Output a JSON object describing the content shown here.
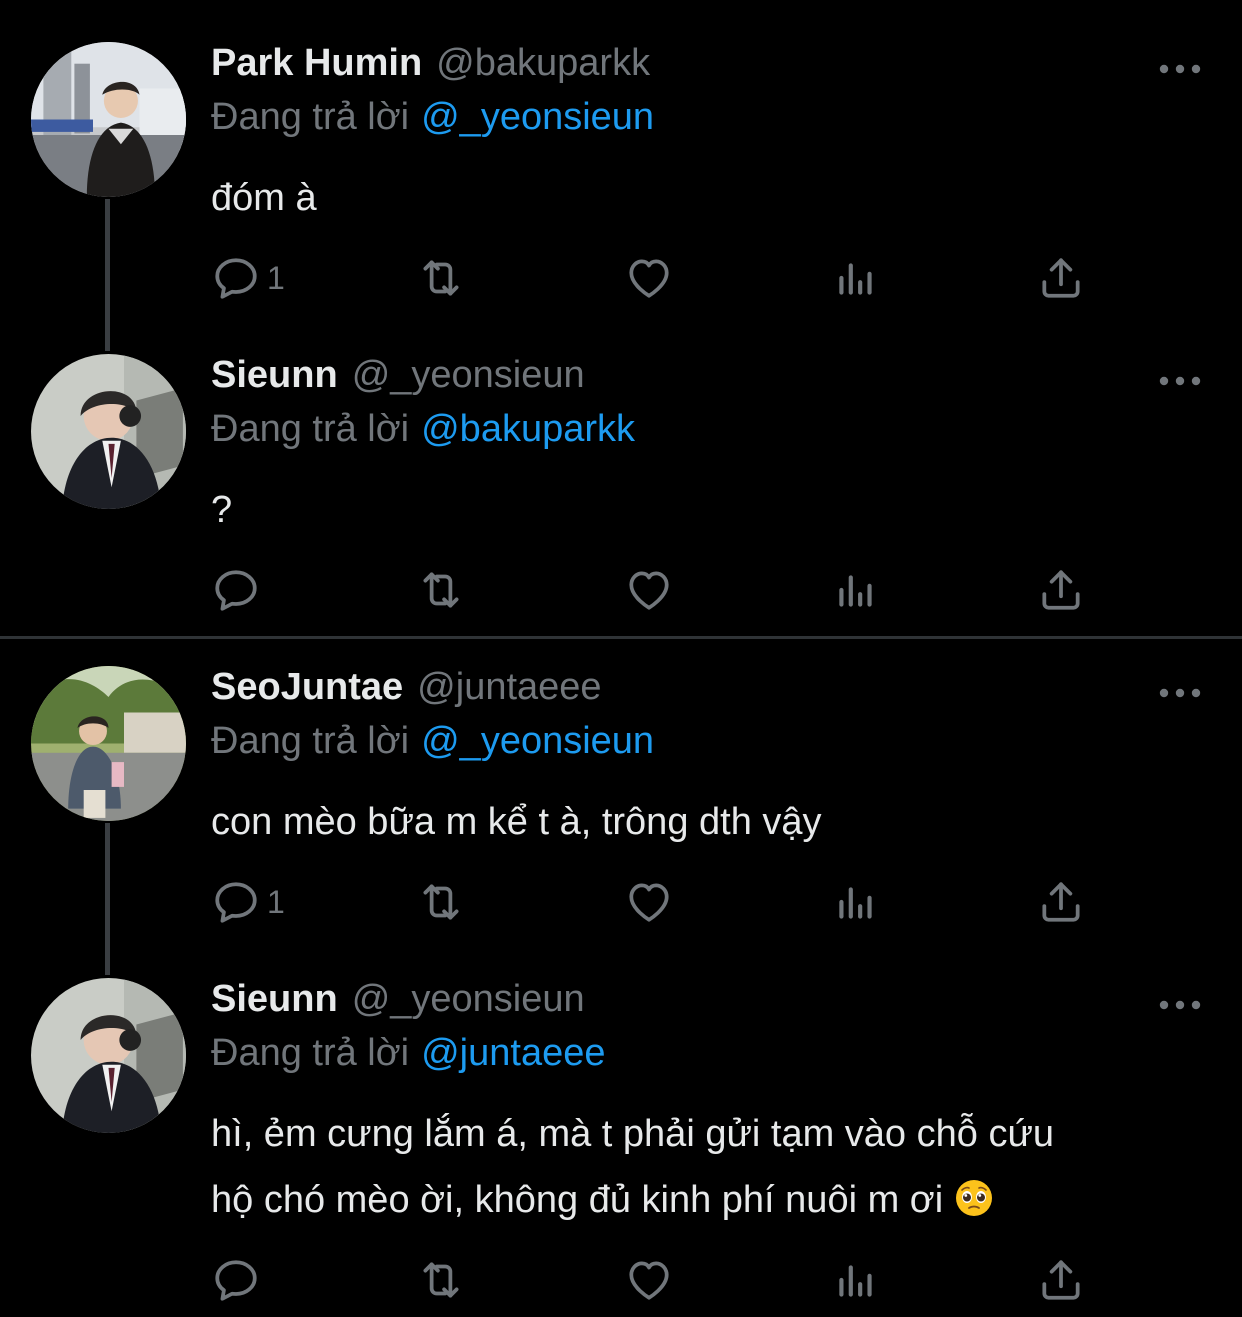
{
  "colors": {
    "background": "#000000",
    "text": "#e7e9ea",
    "muted": "#71767b",
    "link": "#1d9bf0"
  },
  "tweets": [
    {
      "name": "Park Humin",
      "handle": "@bakuparkk",
      "replying_label": "Đang trả lời",
      "replying_to": "@_yeonsieun",
      "text": "đóm à",
      "reply_count": "1"
    },
    {
      "name": "Sieunn",
      "handle": "@_yeonsieun",
      "replying_label": "Đang trả lời",
      "replying_to": "@bakuparkk",
      "text": "?",
      "reply_count": ""
    },
    {
      "name": "SeoJuntae",
      "handle": "@juntaeee",
      "replying_label": "Đang trả lời",
      "replying_to": "@_yeonsieun",
      "text": "con mèo bữa m kể t à, trông dth vậy",
      "reply_count": "1"
    },
    {
      "name": "Sieunn",
      "handle": "@_yeonsieun",
      "replying_label": "Đang trả lời",
      "replying_to": "@juntaeee",
      "text_line1": "hì, ẻm cưng lắm á, mà t phải gửi tạm vào chỗ cứu",
      "text_line2": "hộ chó mèo ời, không đủ kinh phí nuôi m ơi",
      "emoji": "pleading-face-emoji",
      "reply_count": ""
    }
  ],
  "icons": [
    "reply-icon",
    "retweet-icon",
    "like-icon",
    "views-icon",
    "share-icon",
    "more-icon"
  ]
}
